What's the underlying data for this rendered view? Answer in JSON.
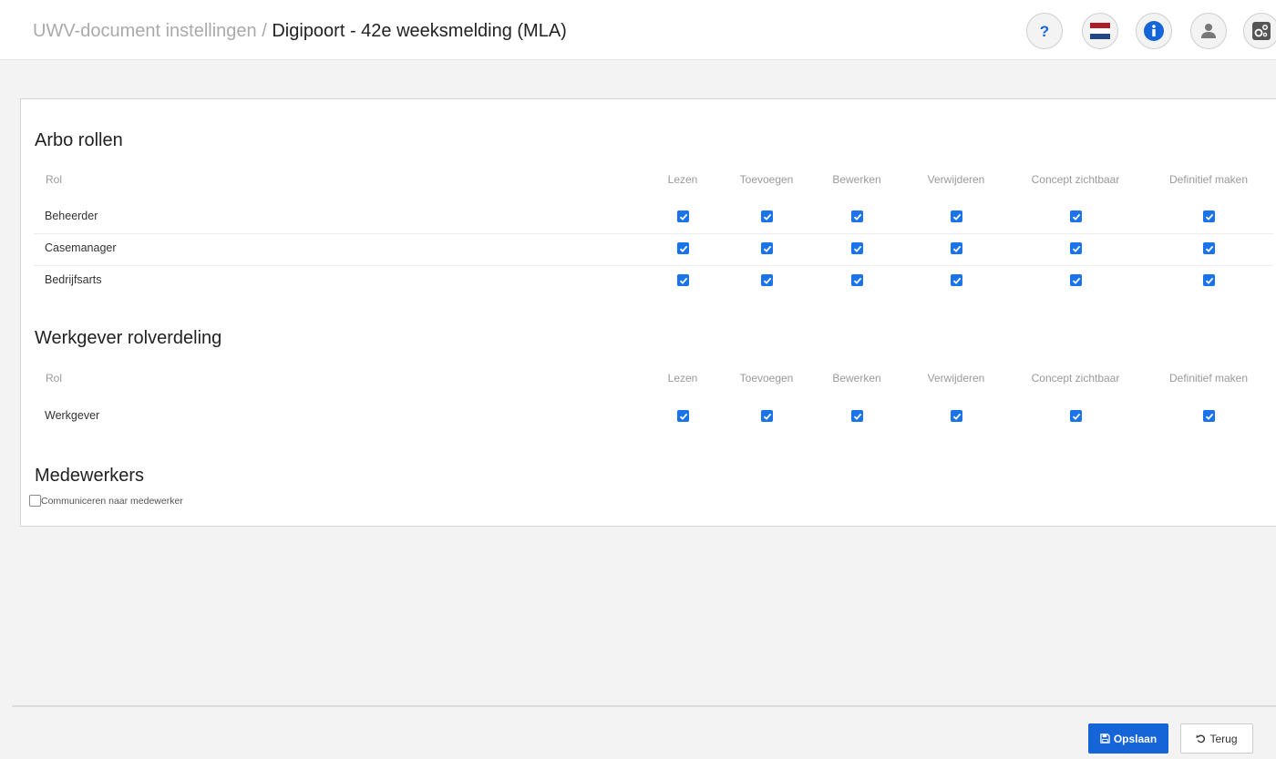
{
  "header": {
    "breadcrumb": "UWV-document instellingen",
    "separator": " / ",
    "title": "Digipoort - 42e weeksmelding (MLA)",
    "icons": [
      "help-icon",
      "language-flag-icon",
      "info-icon",
      "user-icon",
      "settings-icon"
    ]
  },
  "columns": [
    "Lezen",
    "Toevoegen",
    "Bewerken",
    "Verwijderen",
    "Concept zichtbaar",
    "Definitief maken"
  ],
  "arbo": {
    "title": "Arbo rollen",
    "rol_header": "Rol",
    "rows": [
      {
        "label": "Beheerder",
        "checked": [
          true,
          true,
          true,
          true,
          true,
          true
        ]
      },
      {
        "label": "Casemanager",
        "checked": [
          true,
          true,
          true,
          true,
          true,
          true
        ]
      },
      {
        "label": "Bedrijfsarts",
        "checked": [
          true,
          true,
          true,
          true,
          true,
          true
        ]
      }
    ]
  },
  "werkgever": {
    "title": "Werkgever rolverdeling",
    "rol_header": "Rol",
    "rows": [
      {
        "label": "Werkgever",
        "checked": [
          true,
          true,
          true,
          true,
          true,
          true
        ]
      }
    ]
  },
  "medewerkers": {
    "title": "Medewerkers",
    "checkbox_label": "Communiceren naar medewerker",
    "checked": false
  },
  "footer": {
    "save_label": "Opslaan",
    "back_label": "Terug"
  },
  "colors": {
    "accent": "#1565d8",
    "checkbox": "#1a73e8"
  }
}
